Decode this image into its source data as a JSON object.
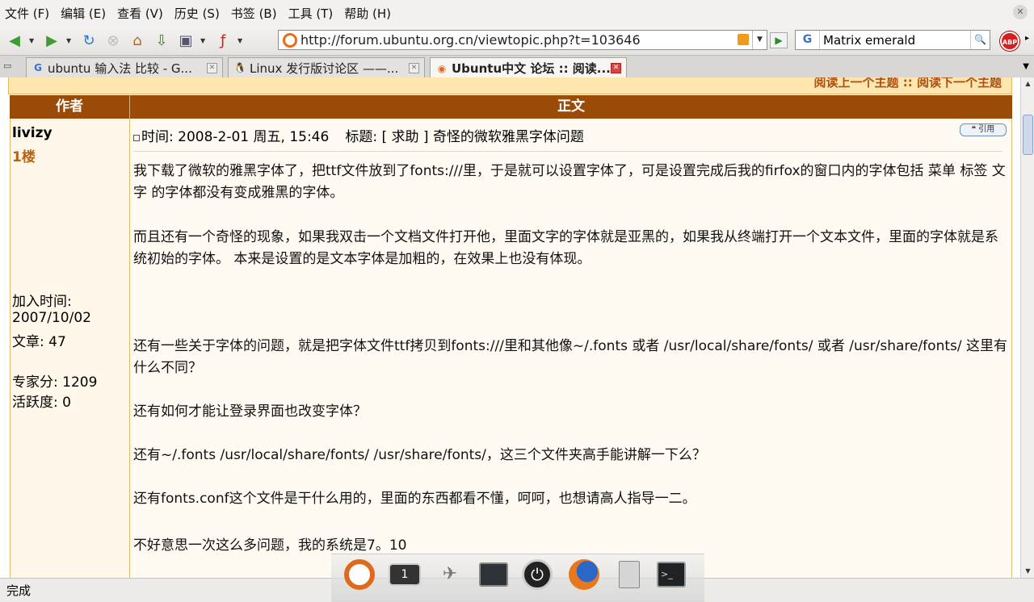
{
  "menu": {
    "items": [
      "文件 (F)",
      "编辑 (E)",
      "查看 (V)",
      "历史 (S)",
      "书签 (B)",
      "工具 (T)",
      "帮助 (H)"
    ]
  },
  "toolbar": {
    "url": "http://forum.ubuntu.org.cn/viewtopic.php?t=103646",
    "search_engine": "G",
    "search_value": "Matrix emerald",
    "abp_label": "ABP",
    "icons": [
      "back-icon",
      "forward-icon",
      "reload-icon",
      "stop-icon",
      "home-icon",
      "downloads-icon",
      "screenshot-icon",
      "acrobat-icon",
      "rss-icon",
      "go-icon",
      "search-icon",
      "adblock-icon"
    ]
  },
  "tabs": [
    {
      "label": "ubuntu 输入法 比较 - G...",
      "favicon": "G"
    },
    {
      "label": "Linux 发行版讨论区 ——...",
      "favicon": "tux"
    },
    {
      "label": "Ubuntu中文 论坛 :: 阅读...",
      "favicon": "ubuntu",
      "active": true
    }
  ],
  "forum": {
    "nav_links": "阅读上一个主题 :: 阅读下一个主题",
    "col_author": "作者",
    "col_body": "正文",
    "author": {
      "name": "livizy",
      "floor": "1楼",
      "joined_label": "加入时间:",
      "joined_date": "2007/10/02",
      "posts": "文章: 47",
      "expert": "专家分: 1209",
      "activity": "活跃度: 0"
    },
    "post": {
      "time": "时间: 2008-2-01 周五, 15:46",
      "title": "标题: [ 求助 ] 奇怪的微软雅黑字体问题",
      "quote_label": "引用",
      "paragraphs": [
        "我下载了微软的雅黑字体了，把ttf文件放到了fonts:///里，于是就可以设置字体了，可是设置完成后我的firfox的窗口内的字体包括 菜单 标签 文字 的字体都没有变成雅黑的字体。",
        "而且还有一个奇怪的现象，如果我双击一个文档文件打开他，里面文字的字体就是亚黑的，如果我从终端打开一个文本文件，里面的字体就是系统初始的字体。 本来是设置的是文本字体是加粗的，在效果上也没有体现。",
        "还有一些关于字体的问题，就是把字体文件ttf拷贝到fonts:///里和其他像~/.fonts 或者 /usr/local/share/fonts/ 或者 /usr/share/fonts/ 这里有什么不同？",
        "还有如何才能让登录界面也改变字体？",
        "还有~/.fonts /usr/local/share/fonts/ /usr/share/fonts/，这三个文件夹高手能讲解一下么？",
        "还有fonts.conf这个文件是干什么用的，里面的东西都看不懂，呵呵，也想请高人指导一二。",
        "不好意思一次这么多问题，我的系统是7。10"
      ]
    }
  },
  "status": {
    "text": "完成"
  },
  "dock": {
    "items": [
      "ubuntu-icon",
      "workspace-icon",
      "network-icon",
      "terminal-icon",
      "power-icon",
      "firefox-icon",
      "file-cabinet-icon",
      "terminal2-icon"
    ],
    "workspace_number": "1"
  }
}
